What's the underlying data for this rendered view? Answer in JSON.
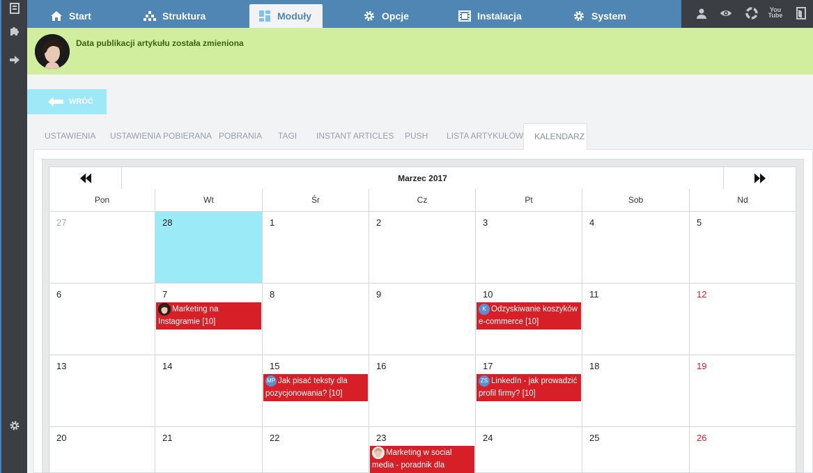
{
  "topnav": {
    "tabs": [
      {
        "label": "Start",
        "icon": "home-icon"
      },
      {
        "label": "Struktura",
        "icon": "sitemap-icon"
      },
      {
        "label": "Moduły",
        "icon": "grid-icon",
        "active": true
      },
      {
        "label": "Opcje",
        "icon": "gear-icon"
      },
      {
        "label": "Instalacja",
        "icon": "film-icon"
      },
      {
        "label": "System",
        "icon": "gear-icon"
      }
    ],
    "right_icons": [
      "user-icon",
      "eye-icon",
      "lifebuoy-icon",
      "youtube-icon",
      "logout-icon"
    ],
    "youtube_text": "You\nTube"
  },
  "sidebar": {
    "icons": [
      "document-icon",
      "puzzle-icon",
      "arrow-right-icon",
      "gear-icon"
    ]
  },
  "banner": {
    "message": "Data publikacji artykułu została zmieniona"
  },
  "back_button": {
    "label": "WRÓĆ"
  },
  "module_tabs": [
    {
      "label": "USTAWIENIA"
    },
    {
      "label": "USTAWIENIA POBIERANA"
    },
    {
      "label": "POBRANIA"
    },
    {
      "label": "TAGI"
    },
    {
      "label": "INSTANT ARTICLES"
    },
    {
      "label": "PUSH"
    },
    {
      "label": "LISTA ARTYKUŁÓW"
    },
    {
      "label": "KALENDARZ",
      "active": true
    }
  ],
  "calendar": {
    "title": "Marzec 2017",
    "weekdays": [
      "Pon",
      "Wt",
      "Śr",
      "Cz",
      "Pt",
      "Sob",
      "Nd"
    ],
    "weeks": [
      [
        {
          "day": "27",
          "muted": true
        },
        {
          "day": "28",
          "today": true
        },
        {
          "day": "1"
        },
        {
          "day": "2"
        },
        {
          "day": "3"
        },
        {
          "day": "4"
        },
        {
          "day": "5"
        }
      ],
      [
        {
          "day": "6"
        },
        {
          "day": "7",
          "event": {
            "title": "Marketing na Instagramie [10]",
            "avatar": "photo"
          }
        },
        {
          "day": "8"
        },
        {
          "day": "9"
        },
        {
          "day": "10",
          "event": {
            "title": "Odzyskiwanie koszyków e-commerce [10]",
            "avatar": "K"
          }
        },
        {
          "day": "11"
        },
        {
          "day": "12",
          "sunday": true
        }
      ],
      [
        {
          "day": "13"
        },
        {
          "day": "14"
        },
        {
          "day": "15",
          "event": {
            "title": "Jak pisać teksty dla pozycjonowania? [10]",
            "avatar": "MP"
          }
        },
        {
          "day": "16"
        },
        {
          "day": "17",
          "event": {
            "title": "LinkedIn - jak prowadzić profil firmy? [10]",
            "avatar": "ZS"
          }
        },
        {
          "day": "18"
        },
        {
          "day": "19",
          "sunday": true
        }
      ],
      [
        {
          "day": "20"
        },
        {
          "day": "21"
        },
        {
          "day": "22"
        },
        {
          "day": "23",
          "event": {
            "title": "Marketing w social media - poradnik dla",
            "avatar": "photo-light"
          }
        },
        {
          "day": "24"
        },
        {
          "day": "25"
        },
        {
          "day": "26",
          "sunday": true
        }
      ]
    ]
  },
  "colors": {
    "nav_blue": "#4f86b4",
    "dark": "#3b3e42",
    "banner_green": "#d1ee9f",
    "today_cyan": "#9beaf8",
    "event_red": "#d61f26",
    "sunday_red": "#dd1f1f"
  }
}
